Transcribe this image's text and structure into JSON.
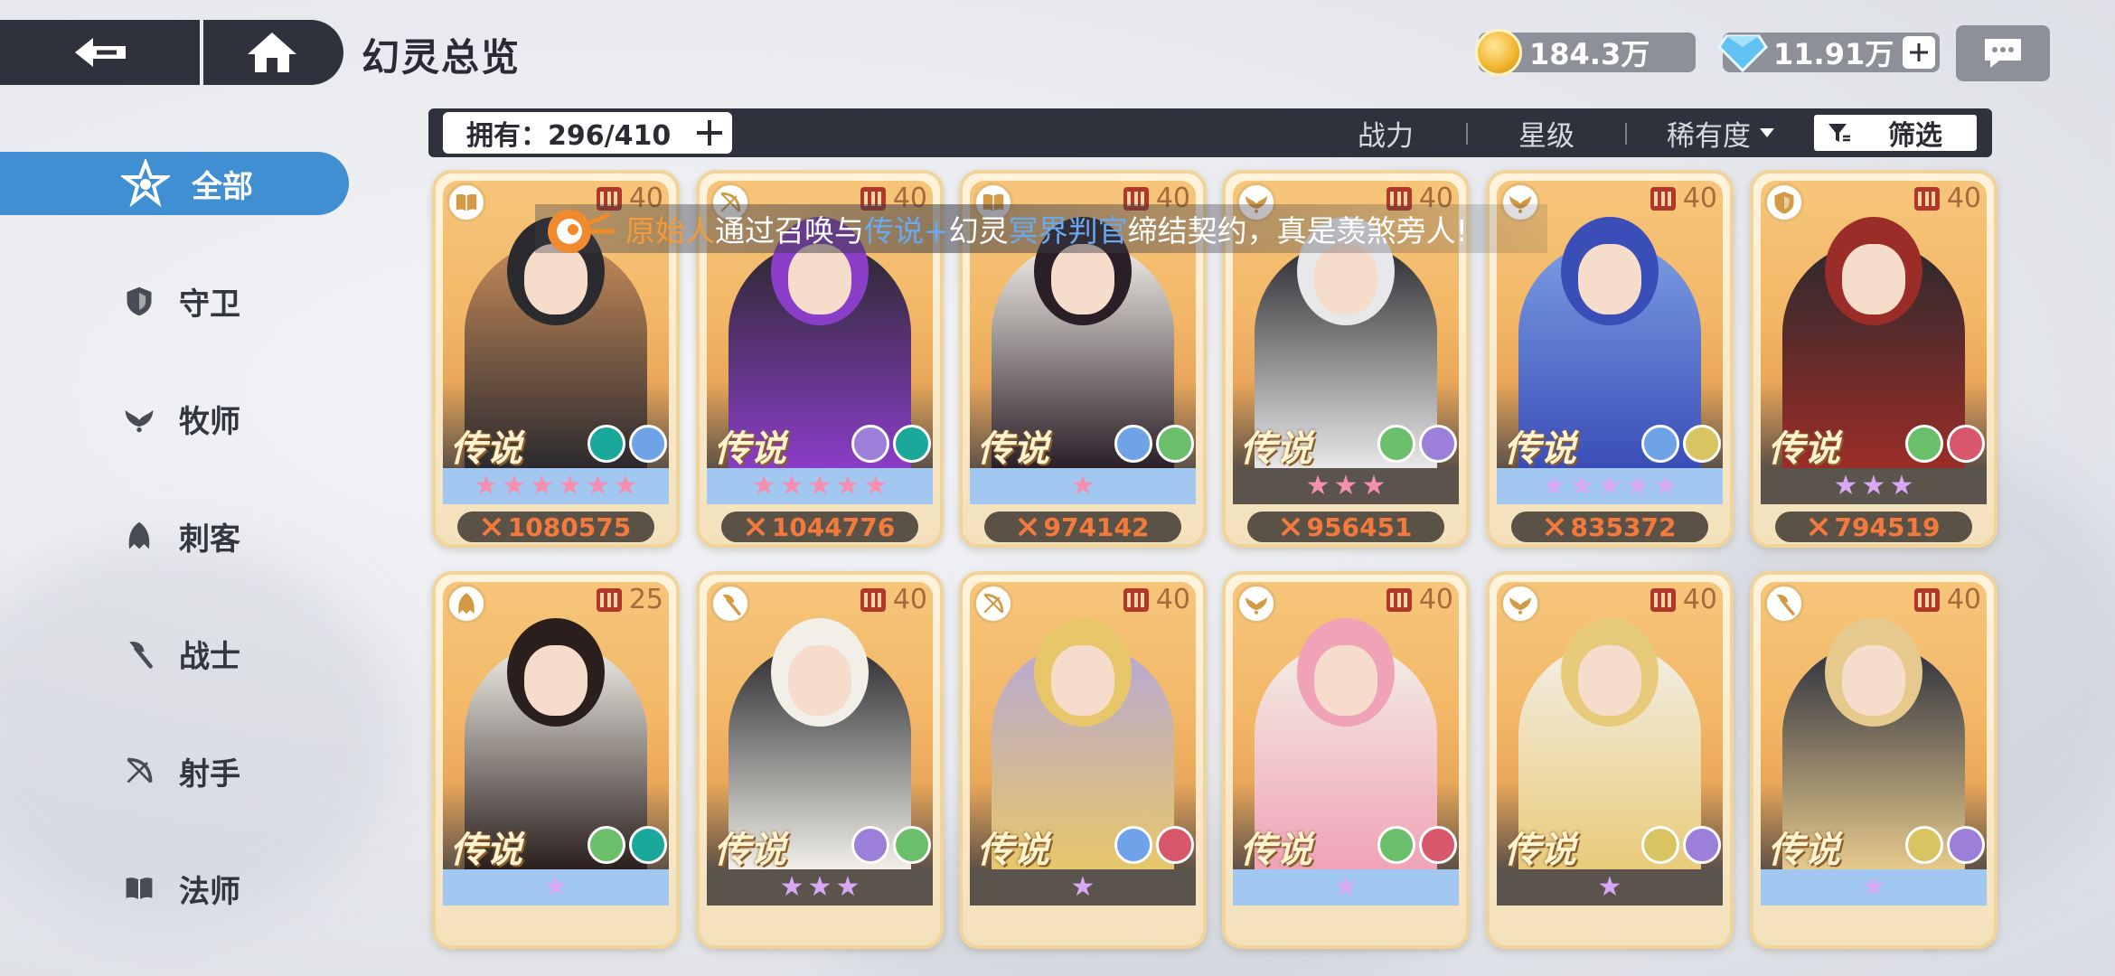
{
  "header": {
    "title": "幻灵总览",
    "gold": "184.3万",
    "gems": "11.91万"
  },
  "sidebar": {
    "items": [
      {
        "label": "全部",
        "icon": "all-class-icon",
        "active": true
      },
      {
        "label": "守卫",
        "icon": "shield-icon",
        "active": false
      },
      {
        "label": "牧师",
        "icon": "priest-wings-icon",
        "active": false
      },
      {
        "label": "刺客",
        "icon": "assassin-hood-icon",
        "active": false
      },
      {
        "label": "战士",
        "icon": "axe-icon",
        "active": false
      },
      {
        "label": "射手",
        "icon": "bow-icon",
        "active": false
      },
      {
        "label": "法师",
        "icon": "book-icon",
        "active": false
      }
    ]
  },
  "filter_bar": {
    "owned_label": "拥有：296/410",
    "sort_power": "战力",
    "sort_stars": "星级",
    "sort_rarity": "稀有度",
    "filter_label": "筛选"
  },
  "broadcast": {
    "player": "原始人",
    "text1": "通过召唤与",
    "rarity": "传说+",
    "text2": "幻灵",
    "spirit": "冥界判官",
    "text3": "缔结契约，真是羡煞旁人!"
  },
  "cards": [
    {
      "level": "40",
      "rarity": "传说",
      "stars": 6,
      "star_color": "#f58fb0",
      "bar": "blue",
      "power": "1080575",
      "class_icon": "book-icon",
      "elements": [
        "#1aa89a",
        "#6fa3e8"
      ],
      "palette": [
        "#2b2a2e",
        "#c58a58"
      ]
    },
    {
      "level": "40",
      "rarity": "传说",
      "stars": 5,
      "star_color": "#f58fb0",
      "bar": "blue",
      "power": "1044776",
      "class_icon": "bow-icon",
      "elements": [
        "#9b7fd8",
        "#1aa89a"
      ],
      "palette": [
        "#8a3dc7",
        "#2b2a2e"
      ]
    },
    {
      "level": "40",
      "rarity": "传说",
      "stars": 1,
      "star_color": "#f58fb0",
      "bar": "blue",
      "power": "974142",
      "class_icon": "book-icon",
      "elements": [
        "#6fa3e8",
        "#6cbf6a"
      ],
      "palette": [
        "#2a1f27",
        "#f2efe9"
      ]
    },
    {
      "level": "40",
      "rarity": "传说",
      "stars": 3,
      "star_color": "#f58fb0",
      "bar": "dark",
      "power": "956451",
      "class_icon": "priest-wings-icon",
      "elements": [
        "#6cbf6a",
        "#9b7fd8"
      ],
      "palette": [
        "#e8e8ea",
        "#2b2a2e"
      ]
    },
    {
      "level": "40",
      "rarity": "传说",
      "stars": 5,
      "star_color": "#d9a8f5",
      "bar": "blue",
      "power": "835372",
      "class_icon": "priest-wings-icon",
      "elements": [
        "#6fa3e8",
        "#d8c460"
      ],
      "palette": [
        "#3a4eb7",
        "#7a9ce2"
      ]
    },
    {
      "level": "40",
      "rarity": "传说",
      "stars": 3,
      "star_color": "#d9a8f5",
      "bar": "dark",
      "power": "794519",
      "class_icon": "shield-icon",
      "elements": [
        "#6cbf6a",
        "#d8576a"
      ],
      "palette": [
        "#9b2d28",
        "#2b2a2e"
      ]
    },
    {
      "level": "25",
      "rarity": "传说",
      "stars": 1,
      "star_color": "#d9a8f5",
      "bar": "blue",
      "power": "",
      "class_icon": "assassin-hood-icon",
      "elements": [
        "#6cbf6a",
        "#1aa89a"
      ],
      "palette": [
        "#2a1f1c",
        "#f1efe8"
      ]
    },
    {
      "level": "40",
      "rarity": "传说",
      "stars": 3,
      "star_color": "#d9a8f5",
      "bar": "dark",
      "power": "",
      "class_icon": "axe-icon",
      "elements": [
        "#9b7fd8",
        "#6cbf6a"
      ],
      "palette": [
        "#f1efe8",
        "#2b2a2e"
      ]
    },
    {
      "level": "40",
      "rarity": "传说",
      "stars": 1,
      "star_color": "#d9a8f5",
      "bar": "dark",
      "power": "",
      "class_icon": "bow-icon",
      "elements": [
        "#6fa3e8",
        "#d8576a"
      ],
      "palette": [
        "#e7c76a",
        "#b7a8d6"
      ]
    },
    {
      "level": "40",
      "rarity": "传说",
      "stars": 1,
      "star_color": "#d9a8f5",
      "bar": "blue",
      "power": "",
      "class_icon": "priest-wings-icon",
      "elements": [
        "#6cbf6a",
        "#d8576a"
      ],
      "palette": [
        "#f0a3b6",
        "#f3eee6"
      ]
    },
    {
      "level": "40",
      "rarity": "传说",
      "stars": 1,
      "star_color": "#d9a8f5",
      "bar": "dark",
      "power": "",
      "class_icon": "priest-wings-icon",
      "elements": [
        "#d8c460",
        "#9b7fd8"
      ],
      "palette": [
        "#e8cb7a",
        "#f3eee6"
      ]
    },
    {
      "level": "40",
      "rarity": "传说",
      "stars": 1,
      "star_color": "#d9a8f5",
      "bar": "blue",
      "power": "",
      "class_icon": "axe-icon",
      "elements": [
        "#d8c460",
        "#9b7fd8"
      ],
      "palette": [
        "#e6c98c",
        "#2b2f3d"
      ]
    }
  ]
}
